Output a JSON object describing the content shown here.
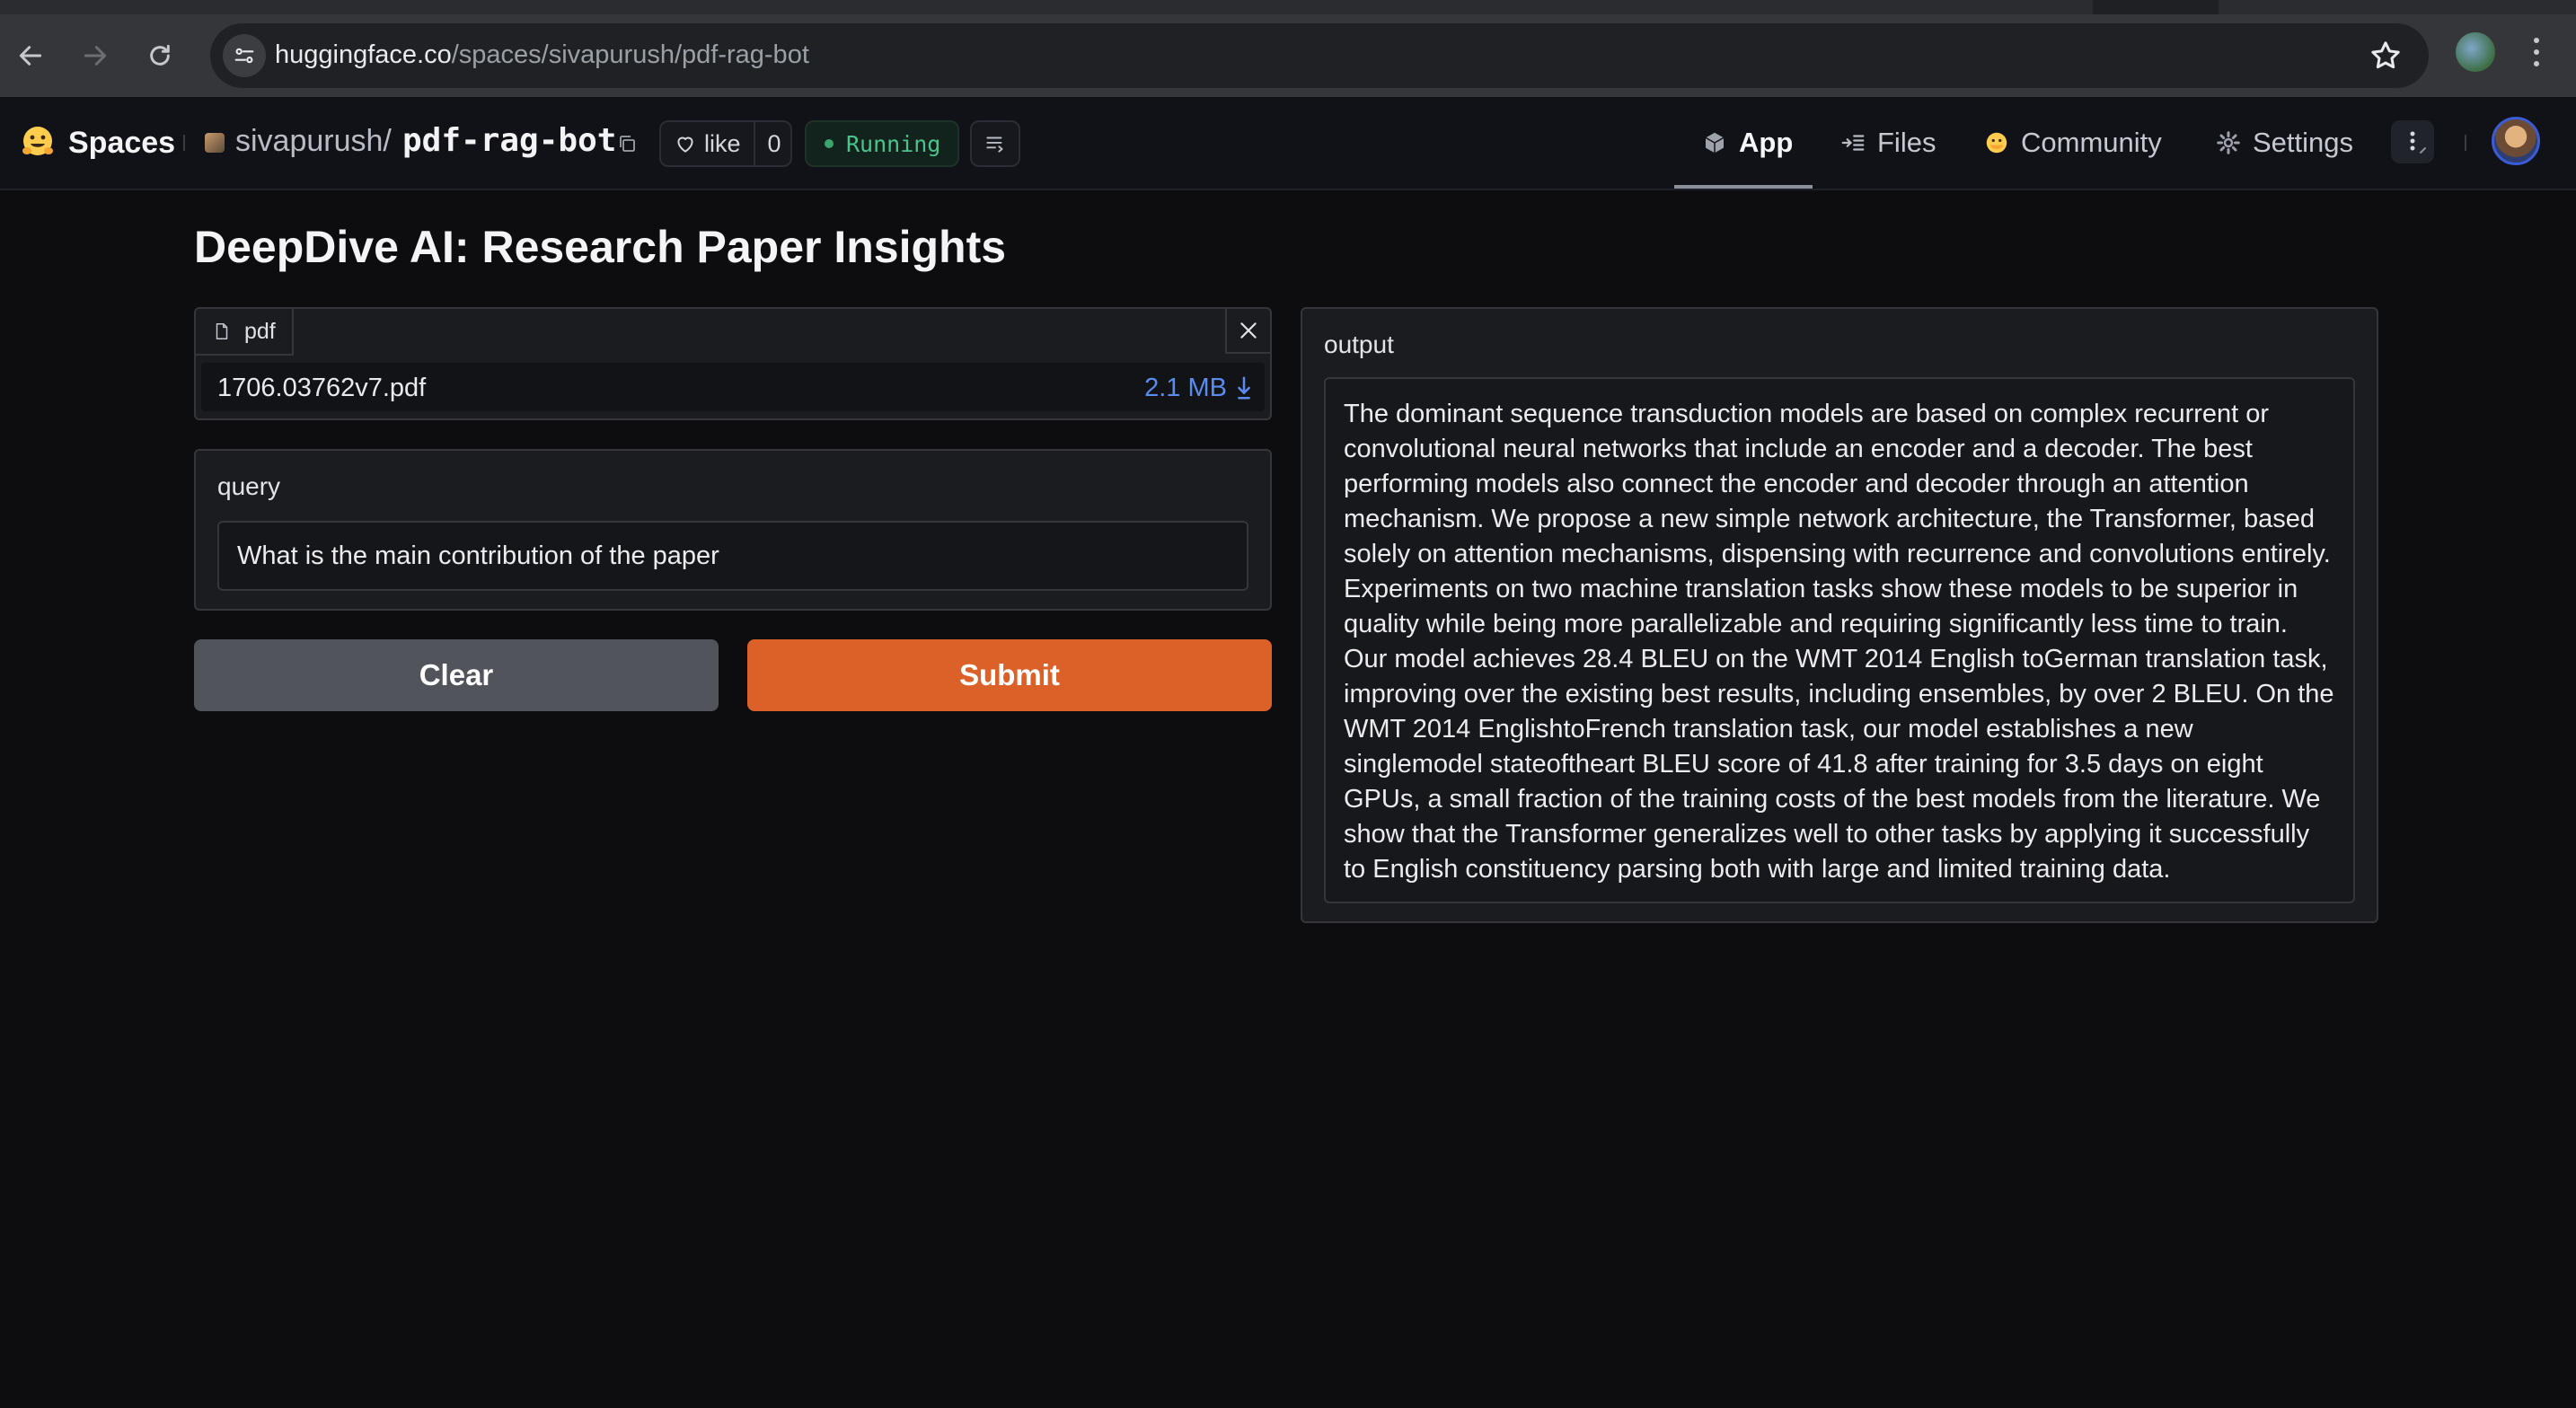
{
  "browser": {
    "url_host": "huggingface.co",
    "url_path": "/spaces/sivapurush/pdf-rag-bot"
  },
  "header": {
    "brand": "Spaces",
    "owner": "sivapurush",
    "separator": "/",
    "repo": "pdf-rag-bot",
    "like_label": "like",
    "like_count": "0",
    "status": "Running",
    "status_color": "#4cc38a",
    "nav_tabs": [
      {
        "label": "App",
        "icon": "cube-icon",
        "active": true
      },
      {
        "label": "Files",
        "icon": "files-icon",
        "active": false
      },
      {
        "label": "Community",
        "icon": "community-icon",
        "active": false
      },
      {
        "label": "Settings",
        "icon": "gear-icon",
        "active": false
      }
    ]
  },
  "app": {
    "title": "DeepDive AI: Research Paper Insights",
    "file": {
      "label": "pdf",
      "name": "1706.03762v7.pdf",
      "size": "2.1 MB"
    },
    "query": {
      "label": "query",
      "value": "What is the main contribution of the paper"
    },
    "buttons": {
      "clear": "Clear",
      "submit": "Submit",
      "submit_color": "#dc6128"
    },
    "output": {
      "label": "output",
      "text": "The dominant sequence transduction models are based on complex recurrent or convolutional neural networks that include an encoder and a decoder. The best performing models also connect the encoder and decoder through an attention mechanism. We propose a new simple network architecture, the Transformer, based solely on attention mechanisms, dispensing with recurrence and convolutions entirely. Experiments on two machine translation tasks show these models to be superior in quality while being more parallelizable and requiring significantly less time to train. Our model achieves 28.4 BLEU on the WMT 2014 English toGerman translation task, improving over the existing best results, including ensembles, by over 2 BLEU. On the WMT 2014 EnglishtoFrench translation task, our model establishes a new singlemodel stateoftheart BLEU score of 41.8 after training for 3.5 days on eight GPUs, a small fraction of the training costs of the best models from the literature. We show that the Transformer generalizes well to other tasks by applying it successfully to English constituency parsing both with large and limited training data."
    }
  }
}
